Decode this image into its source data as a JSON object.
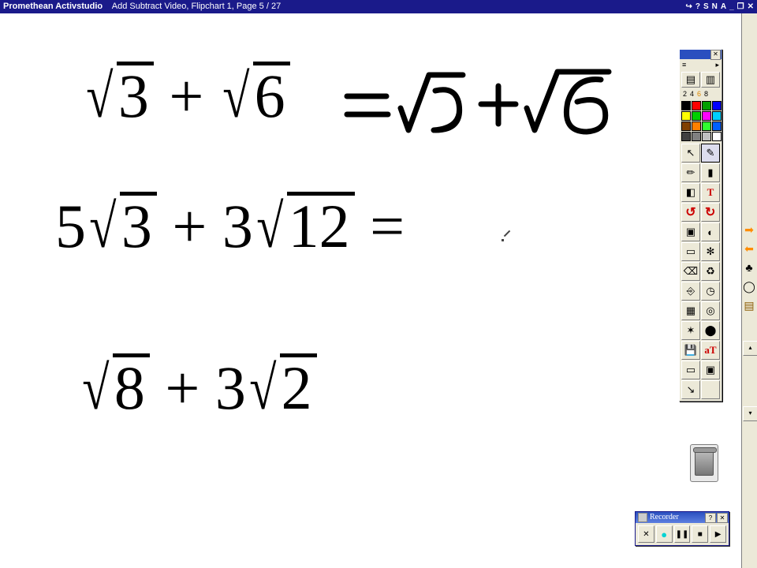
{
  "titlebar": {
    "app": "Promethean Activstudio",
    "doc": "Add Subtract Video,  Flipchart 1,  Page 5 / 27",
    "icons": [
      "↪",
      "?",
      "S",
      "N",
      "A",
      "_",
      "❐",
      "✕"
    ]
  },
  "equations": {
    "eq1": {
      "pre1": "",
      "r1": "3",
      "mid": " + ",
      "pre2": "",
      "r2": "6"
    },
    "eq2": {
      "pre1": "5",
      "r1": "3",
      "mid": " + ",
      "pre2": "3",
      "r2": "12",
      "tail": " ="
    },
    "eq3": {
      "pre1": "",
      "r1": "8",
      "mid": " + ",
      "pre2": "3",
      "r2": "2"
    }
  },
  "handwriting": {
    "answer": "= √3 + √6",
    "equals_stroke": "="
  },
  "toolbox": {
    "close": "✕",
    "strip_left": "≡",
    "strip_right": "▸",
    "sizes": [
      "2",
      "4",
      "6",
      "8"
    ],
    "palette": [
      "#000000",
      "#ff0000",
      "#00a000",
      "#0000ff",
      "#ffff00",
      "#00d000",
      "#ff00ff",
      "#00d0ff",
      "#804000",
      "#ff8000",
      "#30ff30",
      "#0060ff",
      "#404040",
      "#808080",
      "#c0c0c0",
      "#ffffff"
    ],
    "tools": [
      {
        "name": "select-tool",
        "glyph": "↖"
      },
      {
        "name": "pen-tool",
        "glyph": "✎",
        "sel": true
      },
      {
        "name": "highlighter-tool",
        "glyph": "✏"
      },
      {
        "name": "fill-tool",
        "glyph": "▮"
      },
      {
        "name": "eraser-tool",
        "glyph": "◧"
      },
      {
        "name": "text-tool",
        "glyph": "T"
      },
      {
        "name": "undo-tool",
        "glyph": "↺"
      },
      {
        "name": "redo-tool",
        "glyph": "↺"
      },
      {
        "name": "camera-tool",
        "glyph": "▣"
      },
      {
        "name": "reveal-tool",
        "glyph": "◐"
      },
      {
        "name": "snapshot-tool",
        "glyph": "▭"
      },
      {
        "name": "settings-tool",
        "glyph": "✻"
      },
      {
        "name": "clear-tool",
        "glyph": "⌫"
      },
      {
        "name": "recycle-tool",
        "glyph": "♻"
      },
      {
        "name": "link-tool",
        "glyph": "⎆"
      },
      {
        "name": "clock-tool",
        "glyph": "◷"
      },
      {
        "name": "grid-tool",
        "glyph": "▦"
      },
      {
        "name": "search-tool",
        "glyph": "◎"
      },
      {
        "name": "shapes-tool",
        "glyph": "✶"
      },
      {
        "name": "mic-tool",
        "glyph": "⬤"
      },
      {
        "name": "save-tool",
        "glyph": "💾"
      },
      {
        "name": "text-edit-tool",
        "glyph": "aT"
      },
      {
        "name": "rect-tool",
        "glyph": "▭"
      },
      {
        "name": "video-tool",
        "glyph": "▣"
      },
      {
        "name": "pointer-tool",
        "glyph": "↘"
      },
      {
        "name": "blank-tool",
        "glyph": ""
      }
    ]
  },
  "rightstack": [
    {
      "name": "next-arrow-icon",
      "g": "➡",
      "c": "#ff8c00"
    },
    {
      "name": "prev-arrow-icon",
      "g": "➡",
      "c": "#ff8c00"
    },
    {
      "name": "tree-icon",
      "g": "♣",
      "c": "#000"
    },
    {
      "name": "cycle-icon",
      "g": "◯",
      "c": "#000"
    },
    {
      "name": "books-icon",
      "g": "▤",
      "c": "#8a5a00"
    }
  ],
  "scrollbar": {
    "up": "▴",
    "dn": "▾"
  },
  "trash": {},
  "recorder": {
    "title": "Recorder",
    "help": "?",
    "close": "✕",
    "buttons": [
      {
        "name": "close-rec",
        "g": "✕"
      },
      {
        "name": "record-rec",
        "g": "●",
        "cls": "rec"
      },
      {
        "name": "pause-rec",
        "g": "❚❚"
      },
      {
        "name": "stop-rec",
        "g": "■"
      },
      {
        "name": "play-rec",
        "g": "▶"
      }
    ]
  }
}
